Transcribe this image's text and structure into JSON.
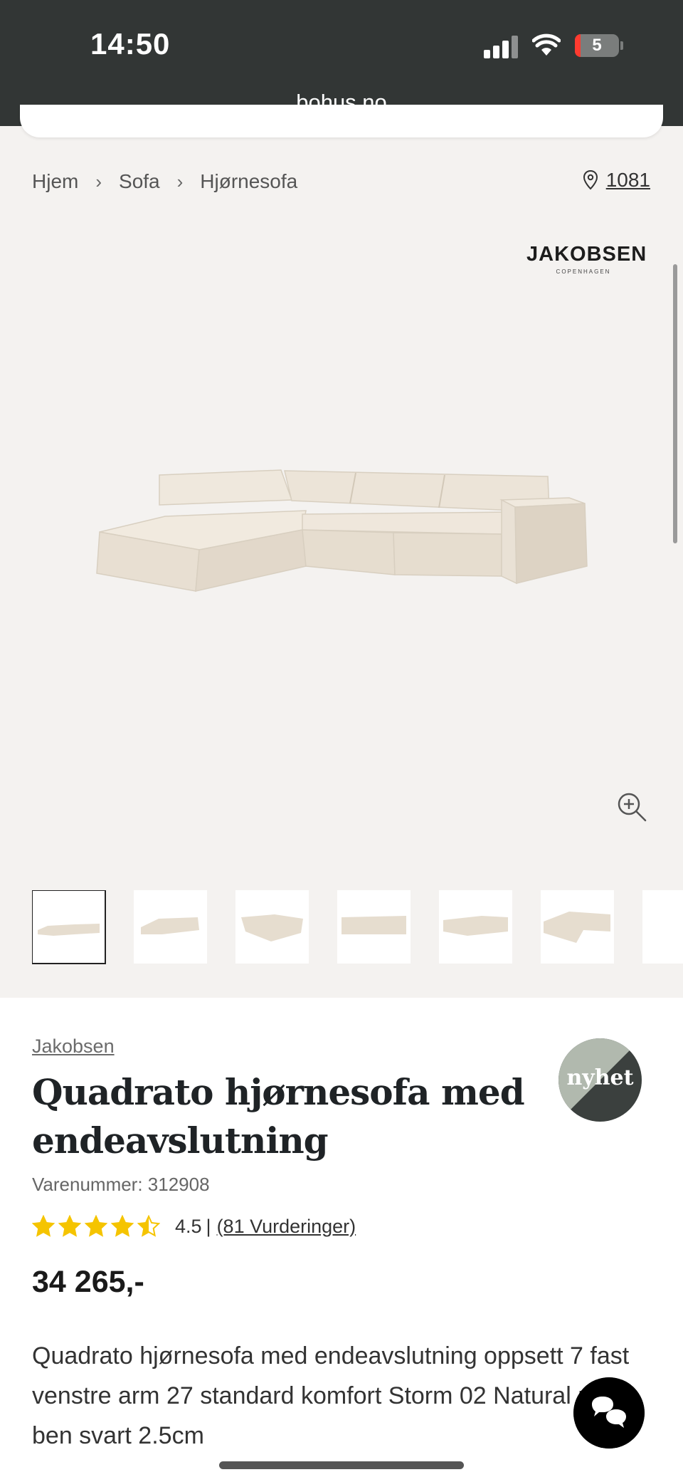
{
  "status_bar": {
    "time": "14:50",
    "url": "bohus.no",
    "battery": "5"
  },
  "breadcrumb": {
    "items": [
      "Hjem",
      "Sofa",
      "Hjørnesofa"
    ],
    "separator": "›"
  },
  "store": {
    "number": "1081"
  },
  "brand_logo": {
    "main": "JAKOBSEN",
    "sub": "COPENHAGEN"
  },
  "product": {
    "brand": "Jakobsen",
    "title": "Quadrato hjørnesofa med endeavslutning",
    "sku": "Varenummer: 312908",
    "rating": {
      "value": "4.5",
      "stars": 4.5,
      "max": 5,
      "separator": "|",
      "count": "(81 Vurderinger)"
    },
    "price": "34 265,-",
    "description": "Quadrato hjørnesofa med endeavslutning oppsett 7 fast venstre arm 27 standard komfort Storm 02 Natural med ben svart 2.5cm"
  },
  "badge": {
    "text": "nyhet"
  },
  "thumbnails": {
    "count": 7,
    "active_index": 0
  },
  "colors": {
    "status_bar": "#323635",
    "gallery_bg": "#f4f2f0",
    "sofa": "#e9e1d5",
    "star": "#f5c400",
    "badge_light": "#b1b9ae",
    "badge_dark": "#3b403e"
  },
  "icons": {
    "location": "map-pin-icon",
    "zoom": "zoom-in-icon",
    "chat": "chat-bubbles-icon",
    "chevron": "chevron-right-icon"
  }
}
